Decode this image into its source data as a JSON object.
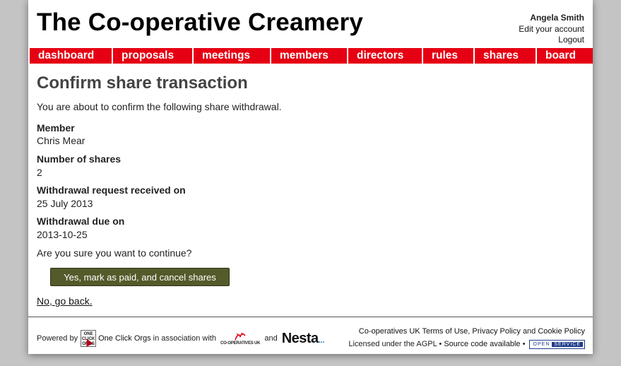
{
  "header": {
    "site_title": "The Co-operative Creamery",
    "user_name": "Angela Smith",
    "edit_account": "Edit your account",
    "logout": "Logout"
  },
  "nav": {
    "items": [
      {
        "label": "dashboard"
      },
      {
        "label": "proposals"
      },
      {
        "label": "meetings"
      },
      {
        "label": "members"
      },
      {
        "label": "directors"
      },
      {
        "label": "rules"
      },
      {
        "label": "shares"
      },
      {
        "label": "board"
      }
    ]
  },
  "main": {
    "heading": "Confirm share transaction",
    "intro": "You are about to confirm the following share withdrawal.",
    "fields": [
      {
        "label": "Member",
        "value": "Chris Mear"
      },
      {
        "label": "Number of shares",
        "value": "2"
      },
      {
        "label": "Withdrawal request received on",
        "value": "25 July 2013"
      },
      {
        "label": "Withdrawal due on",
        "value": "2013-10-25"
      }
    ],
    "question": "Are you sure you want to continue?",
    "confirm_button": "Yes, mark as paid, and cancel shares",
    "back_link": "No, go back."
  },
  "footer": {
    "powered_by": "Powered by",
    "oco_logo_text": "ONE CLICK ORGS",
    "one_click_orgs": "One Click Orgs",
    "in_association": "in association with",
    "coop_logo_text": "CO-OPERATIVES UK",
    "and": "and",
    "nesta_logo_text": "Nesta",
    "nesta_dots": "...",
    "coops_uk": "Co-operatives UK",
    "terms": "Terms of Use",
    "privacy": "Privacy Policy",
    "and2": "and",
    "cookie": "Cookie Policy",
    "licensed": "Licensed under the AGPL",
    "bullet": "•",
    "source_code": "Source code available",
    "badge_open": "OPEN",
    "badge_service": "SERVICE"
  },
  "colors": {
    "nav_background": "#e60013",
    "button_background": "#545a2a"
  }
}
